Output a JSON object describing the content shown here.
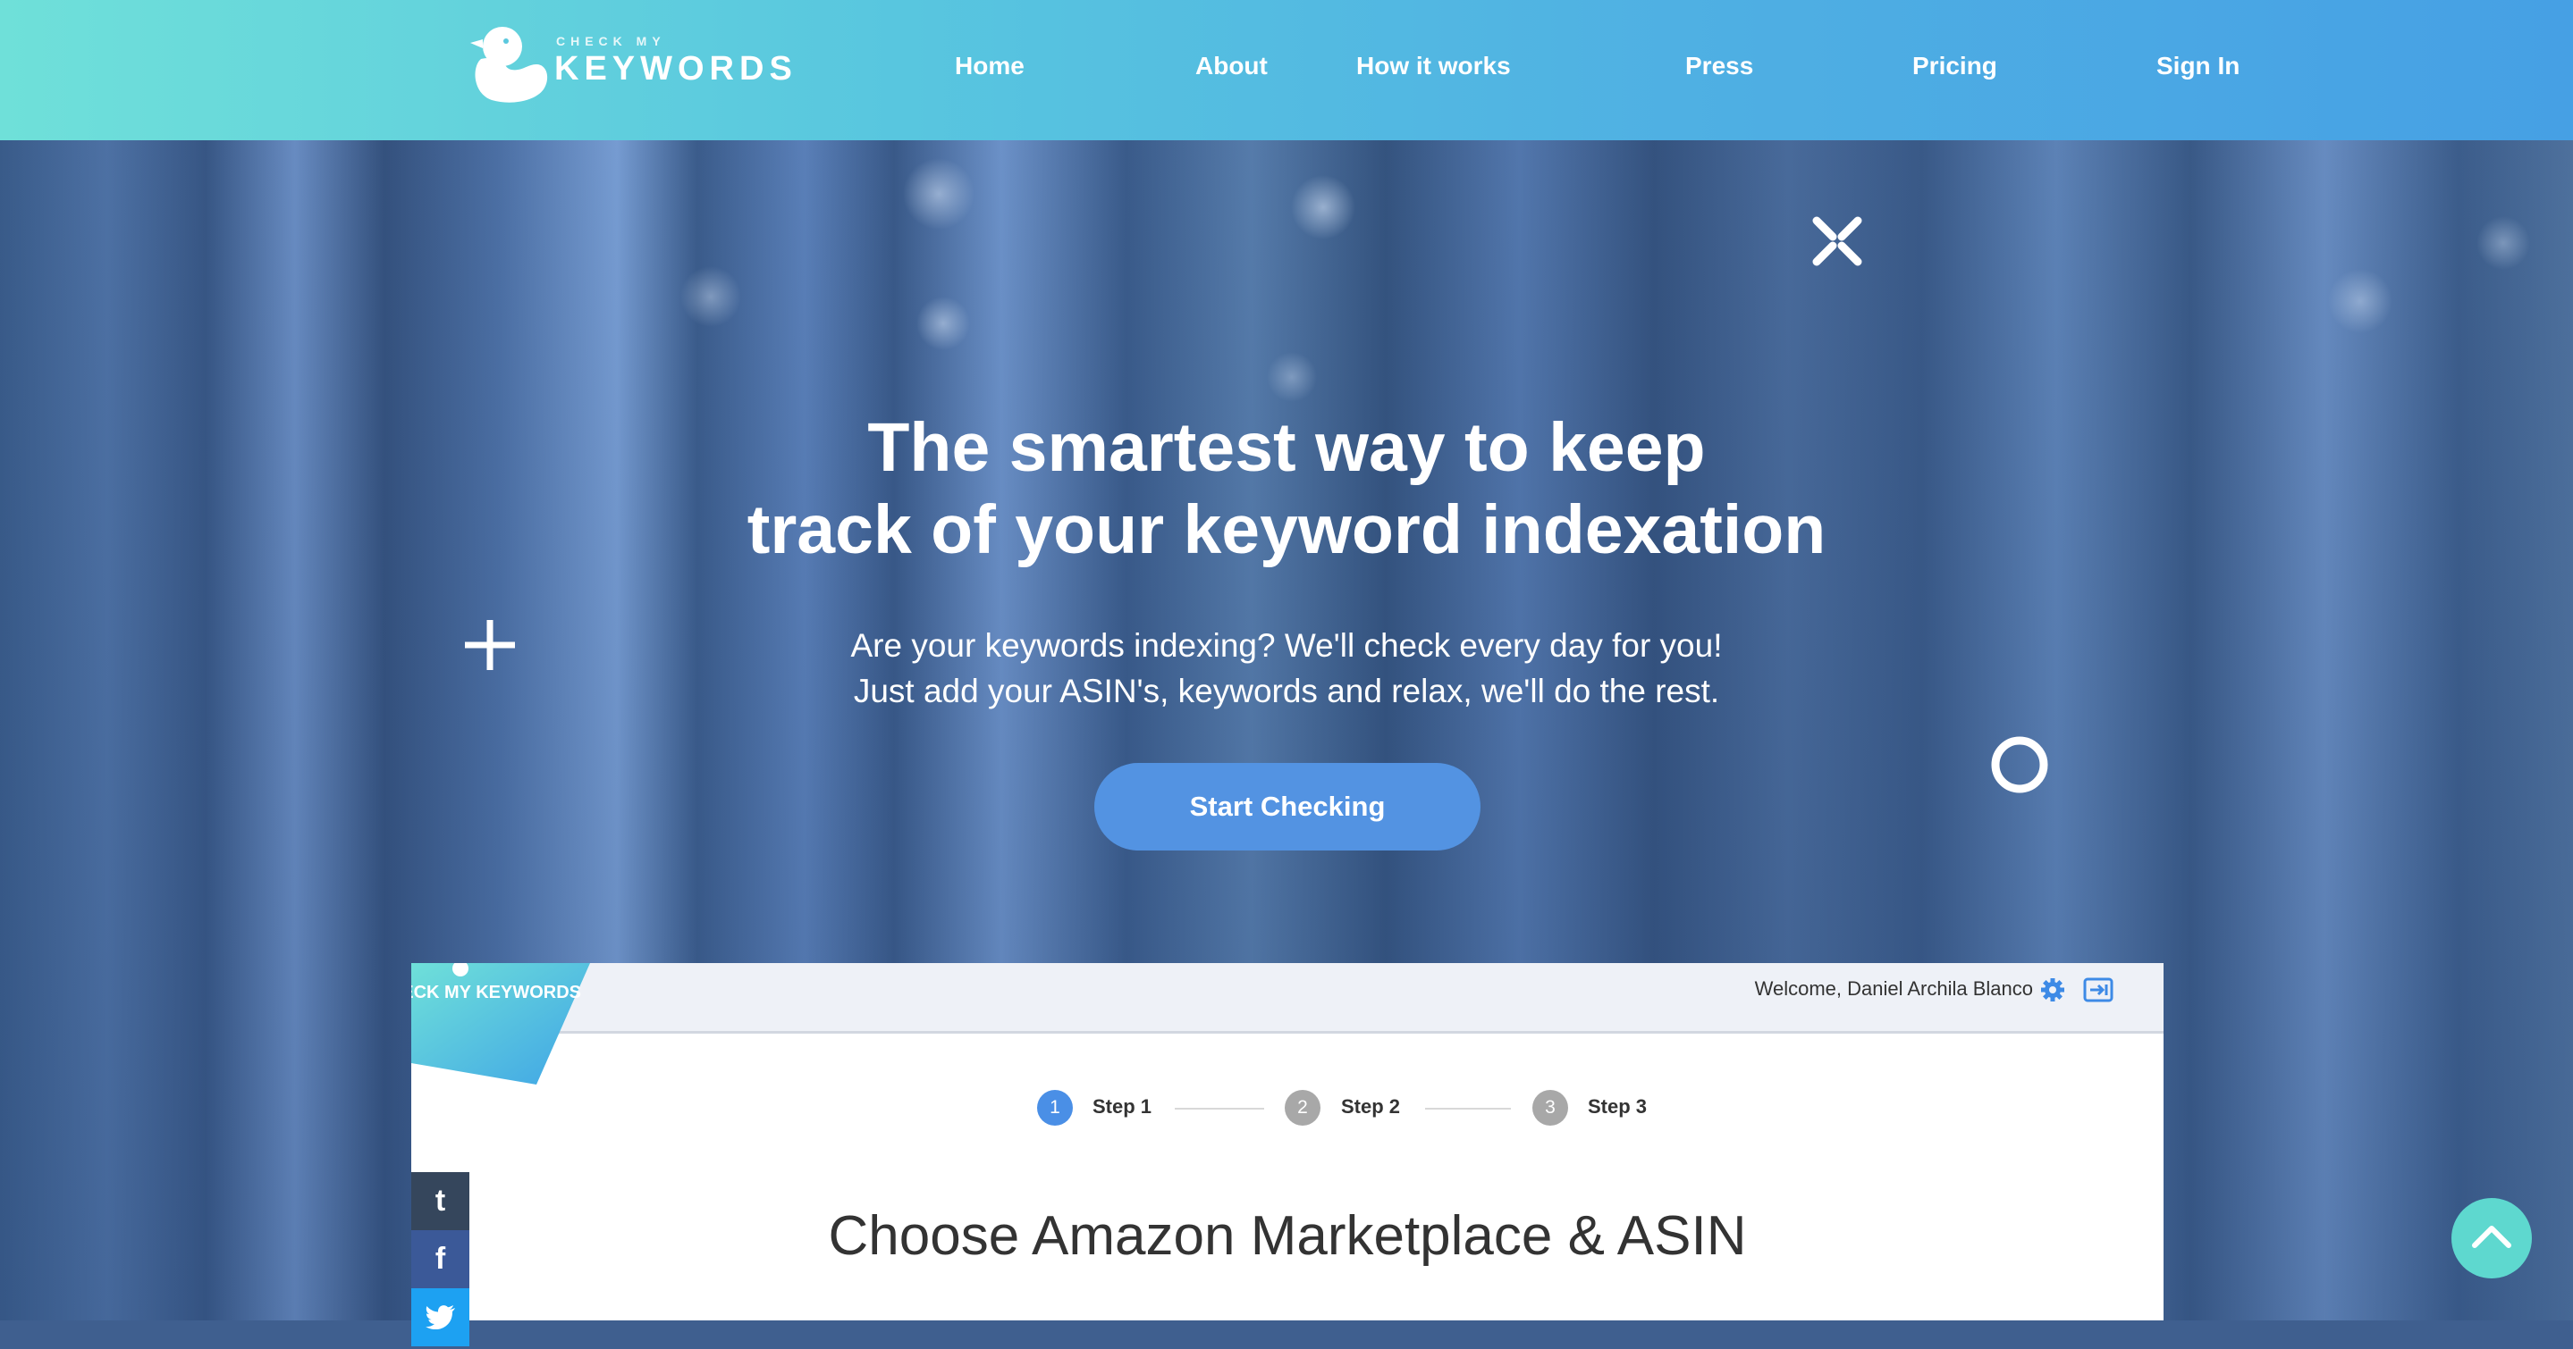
{
  "nav": {
    "logo": {
      "small_text": "CHECK MY",
      "big_text": "KEYWORDS",
      "icon": "duck-logo-icon"
    },
    "links": [
      {
        "label": "Home"
      },
      {
        "label": "About"
      },
      {
        "label": "How it works"
      },
      {
        "label": "Press"
      },
      {
        "label": "Pricing"
      },
      {
        "label": "Sign In"
      }
    ]
  },
  "hero": {
    "headline_line1": "The smartest way to keep",
    "headline_line2": "track of your keyword indexation",
    "sub_line1": "Are your keywords indexing? We'll check every day for you!",
    "sub_line2": "Just add your ASIN's, keywords and relax, we'll do the rest.",
    "cta_label": "Start Checking",
    "decorations": [
      "x-shape-icon",
      "plus-icon",
      "ring-icon"
    ]
  },
  "preview": {
    "logo_text": "CHECK MY KEYWORDS",
    "welcome": "Welcome, Daniel Archila Blanco",
    "steps": [
      {
        "number": "1",
        "label": "Step 1",
        "active": true
      },
      {
        "number": "2",
        "label": "Step 2",
        "active": false
      },
      {
        "number": "3",
        "label": "Step 3",
        "active": false
      }
    ],
    "title": "Choose Amazon Marketplace & ASIN"
  },
  "social": {
    "tumblr": "t",
    "facebook": "f",
    "twitter": "twitter-icon"
  },
  "colors": {
    "nav_gradient_start": "#6fe0d9",
    "nav_gradient_end": "#46a0e4",
    "cta": "#5393e2",
    "step_active": "#4a8fe6",
    "step_inactive": "#a8a8a8",
    "back_to_top": "#5ed8cf"
  }
}
